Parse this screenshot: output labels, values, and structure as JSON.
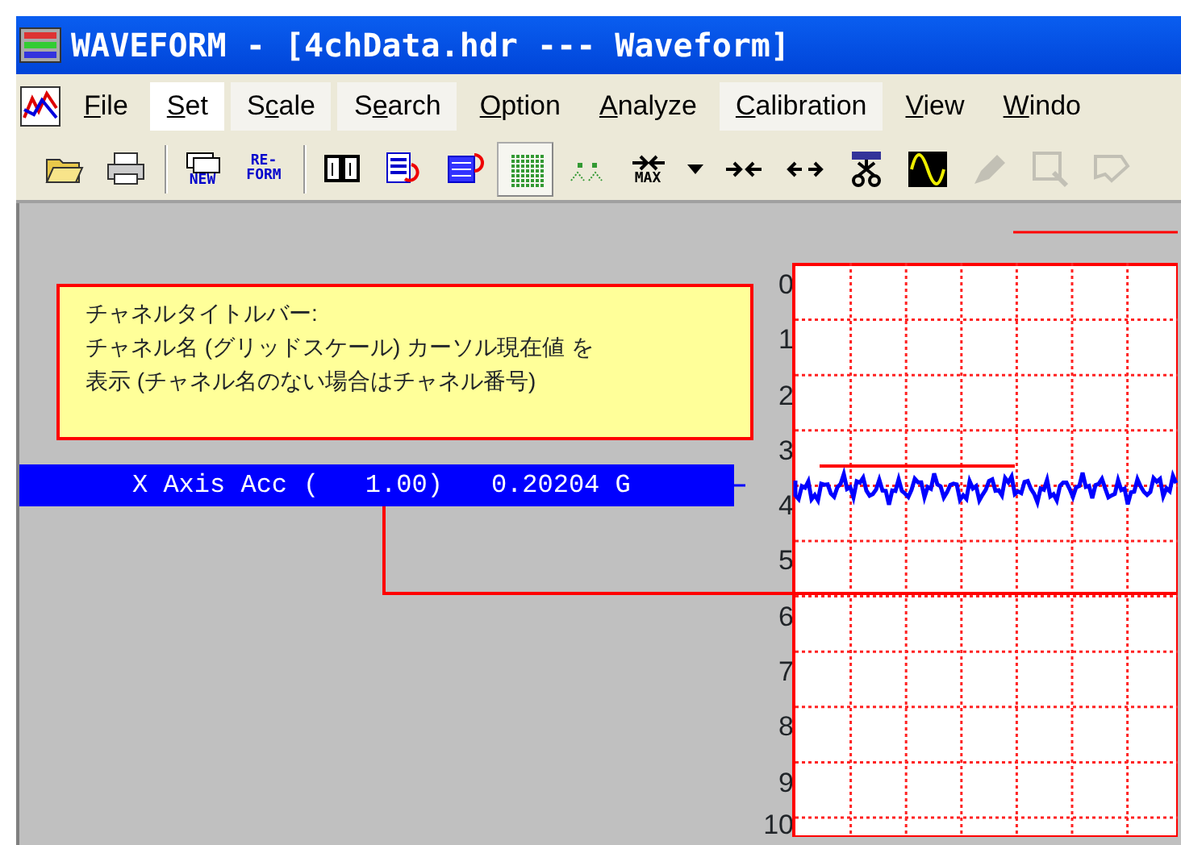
{
  "window": {
    "title": "WAVEFORM - [4chData.hdr --- Waveform]"
  },
  "menu": [
    {
      "key": "F",
      "post": "ile",
      "selected": false,
      "highlighted": false
    },
    {
      "key": "S",
      "post": "et",
      "selected": true,
      "highlighted": false
    },
    {
      "pre": "S",
      "key": "c",
      "post": "ale",
      "selected": false,
      "highlighted": true
    },
    {
      "pre": "S",
      "key": "e",
      "post": "arch",
      "selected": false,
      "highlighted": true
    },
    {
      "key": "O",
      "post": "ption",
      "selected": false,
      "highlighted": false
    },
    {
      "key": "A",
      "post": "nalyze",
      "selected": false,
      "highlighted": false
    },
    {
      "key": "C",
      "post": "alibration",
      "selected": false,
      "highlighted": true
    },
    {
      "key": "V",
      "post": "iew",
      "selected": false,
      "highlighted": false
    },
    {
      "key": "W",
      "post": "indo",
      "selected": false,
      "highlighted": false
    }
  ],
  "toolbar": [
    {
      "kind": "open",
      "pressed": false,
      "disabled": false
    },
    {
      "kind": "print",
      "pressed": false,
      "disabled": false
    },
    {
      "kind": "separator"
    },
    {
      "kind": "new",
      "text": "NEW",
      "pressed": false,
      "disabled": false
    },
    {
      "kind": "reform",
      "text": "RE-\nFORM",
      "pressed": false,
      "disabled": false
    },
    {
      "kind": "separator"
    },
    {
      "kind": "columns",
      "pressed": false,
      "disabled": false
    },
    {
      "kind": "listred",
      "pressed": false,
      "disabled": false
    },
    {
      "kind": "listblue",
      "pressed": false,
      "disabled": false
    },
    {
      "kind": "grid",
      "pressed": true,
      "disabled": false
    },
    {
      "kind": "dots",
      "pressed": false,
      "disabled": false
    },
    {
      "kind": "max",
      "text": "MAX",
      "pressed": false,
      "disabled": false
    },
    {
      "kind": "caret",
      "pressed": false,
      "disabled": false
    },
    {
      "kind": "arrowsin",
      "pressed": false,
      "disabled": false
    },
    {
      "kind": "arrowsout",
      "pressed": false,
      "disabled": false
    },
    {
      "kind": "probe",
      "pressed": false,
      "disabled": false
    },
    {
      "kind": "sine",
      "pressed": false,
      "disabled": false
    },
    {
      "kind": "tool",
      "pressed": false,
      "disabled": true
    },
    {
      "kind": "zoom",
      "pressed": false,
      "disabled": true
    },
    {
      "kind": "flag",
      "pressed": false,
      "disabled": true
    }
  ],
  "callout": {
    "title": "チャネルタイトルバー:",
    "body": "チャネル名 (グリッドスケール) カーソル現在値 を表示 (チャネル名のない場合はチャネル番号)"
  },
  "channel": {
    "name": "X Axis Acc",
    "scale": "(   1.00)",
    "value": "0.20204 G"
  },
  "scale_labels": [
    "0",
    "1",
    "2",
    "3",
    "4",
    "5",
    "6",
    "7",
    "8",
    "9",
    "10"
  ]
}
